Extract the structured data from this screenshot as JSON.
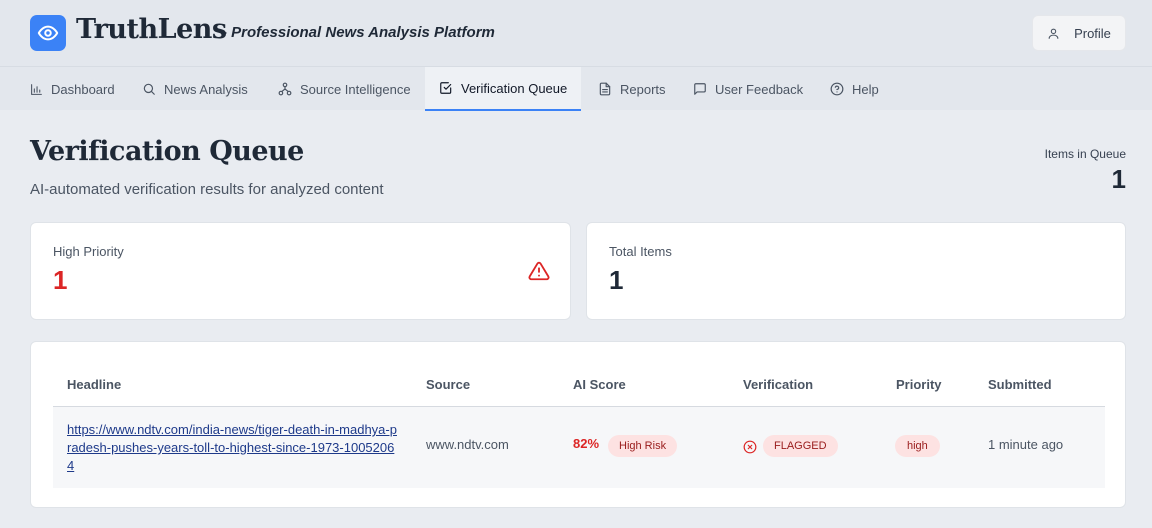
{
  "header": {
    "brand": "TruthLens",
    "tagline": "- Professional News Analysis Platform",
    "profile_label": "Profile"
  },
  "nav": {
    "tabs": [
      {
        "label": "Dashboard",
        "icon": "bar-chart-icon"
      },
      {
        "label": "News Analysis",
        "icon": "search-icon"
      },
      {
        "label": "Source Intelligence",
        "icon": "network-icon"
      },
      {
        "label": "Verification Queue",
        "icon": "check-square-icon",
        "active": true
      },
      {
        "label": "Reports",
        "icon": "document-icon"
      },
      {
        "label": "User Feedback",
        "icon": "chat-icon"
      },
      {
        "label": "Help",
        "icon": "help-circle-icon"
      }
    ]
  },
  "page": {
    "title": "Verification Queue",
    "subtitle": "AI-automated verification results for analyzed content",
    "queue_label": "Items in Queue",
    "queue_count": "1"
  },
  "stats": {
    "high_priority_label": "High Priority",
    "high_priority_value": "1",
    "total_label": "Total Items",
    "total_value": "1"
  },
  "table": {
    "columns": [
      "Headline",
      "Source",
      "AI Score",
      "Verification",
      "Priority",
      "Submitted"
    ],
    "rows": [
      {
        "headline": "https://www.ndtv.com/india-news/tiger-death-in-madhya-pradesh-pushes-years-toll-to-highest-since-1973-10052064",
        "source": "www.ndtv.com",
        "score": "82%",
        "risk": "High Risk",
        "verification": "FLAGGED",
        "priority": "high",
        "submitted": "1 minute ago"
      }
    ]
  },
  "colors": {
    "accent": "#3b82f6",
    "danger": "#dc2626",
    "pill_bg": "#fde2e2"
  }
}
